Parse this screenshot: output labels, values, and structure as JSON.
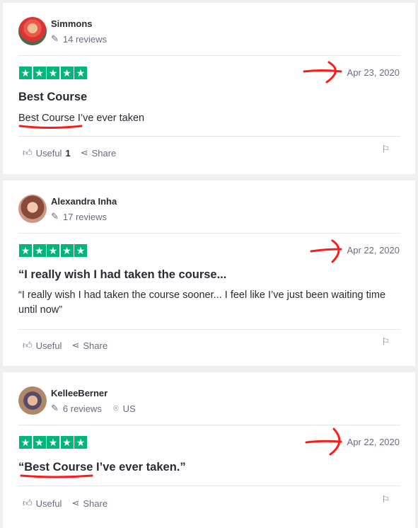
{
  "reviews": [
    {
      "name": "Simmons",
      "reviews": "14 reviews",
      "date": "Apr 23, 2020",
      "title": "Best Course",
      "body": "Best Course I’ve ever taken",
      "useful": "Useful",
      "useful_count": "1",
      "share": "Share",
      "rating": 5
    },
    {
      "name": "Alexandra Inha",
      "reviews": "17 reviews",
      "date": "Apr 22, 2020",
      "title": "“I really wish I had taken the course...",
      "body": "“I really wish I had taken the course sooner... I feel like I’ve just been waiting time until now”",
      "useful": "Useful",
      "share": "Share",
      "rating": 5
    },
    {
      "name": "KelleeBerner",
      "reviews": "6 reviews",
      "location": "US",
      "date": "Apr 22, 2020",
      "title": "“Best Course I’ve ever taken.”",
      "useful": "Useful",
      "share": "Share",
      "rating": 5
    }
  ],
  "colors": {
    "star": "#00b67a",
    "annotation": "#ff1a1a"
  }
}
